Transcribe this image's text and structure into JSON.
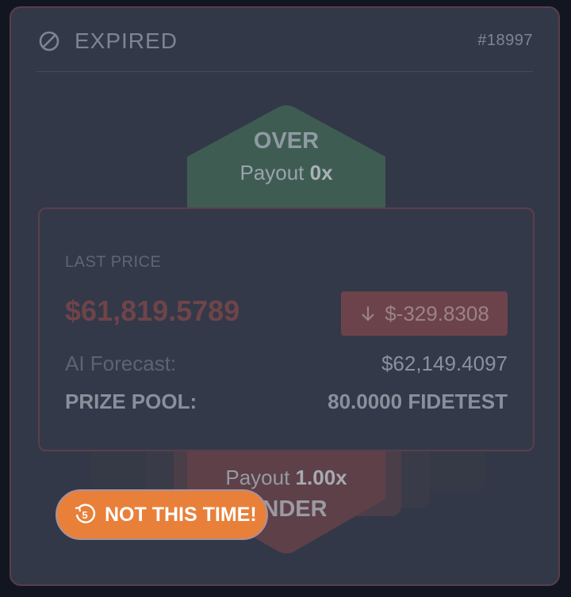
{
  "header": {
    "status_icon": "ban-icon",
    "status_label": "EXPIRED",
    "round_id": "#18997"
  },
  "over": {
    "label": "OVER",
    "payout_label": "Payout",
    "payout_value": "0x"
  },
  "under": {
    "label": "UNDER",
    "payout_label": "Payout",
    "payout_value": "1.00x"
  },
  "panel": {
    "last_price_label": "LAST PRICE",
    "last_price": "$61,819.5789",
    "delta_icon": "arrow-down-icon",
    "delta": "$-329.8308",
    "forecast_label": "AI Forecast:",
    "forecast_value": "$62,149.4097",
    "prize_label": "PRIZE POOL:",
    "prize_value": "80.0000 FIDETEST"
  },
  "toast": {
    "icon": "countdown-5-icon",
    "label": "NOT THIS TIME!"
  },
  "colors": {
    "card_bg": "#323848",
    "border": "#5a3d4a",
    "over_green": "#3f5c53",
    "under_red": "#5d4048",
    "negative_red": "#6f4449",
    "toast_orange": "#e8803a"
  }
}
